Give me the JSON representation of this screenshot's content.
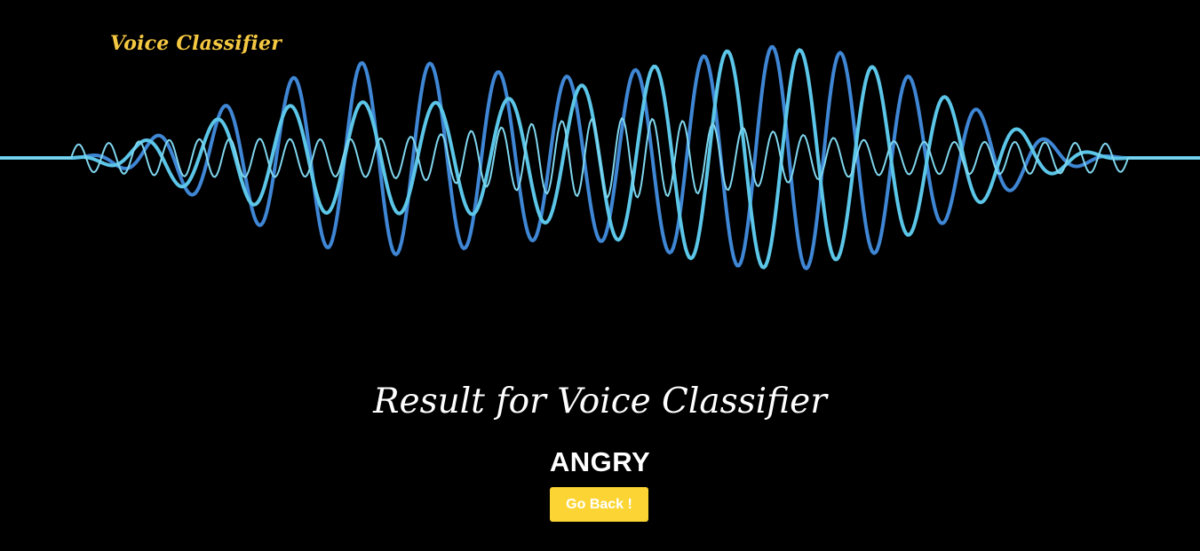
{
  "header": {
    "brand": "Voice Classifier"
  },
  "main": {
    "title": "Result for Voice Classifier",
    "result": "ANGRY",
    "back_button": "Go Back !"
  },
  "colors": {
    "background": "#000000",
    "brand": "#f5c842",
    "button": "#fcd535",
    "wave_dark": "#3f86d4",
    "wave_light": "#5cc6e8"
  }
}
